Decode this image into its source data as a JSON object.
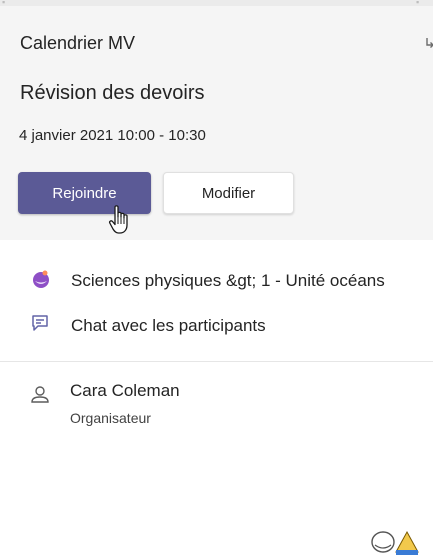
{
  "calendar": {
    "name": "Calendrier MV"
  },
  "meeting": {
    "title": "Révision des devoirs",
    "datetime": "4 janvier 2021 10:00 - 10:30"
  },
  "actions": {
    "join_label": "Rejoindre",
    "edit_label": "Modifier"
  },
  "channel": {
    "label": "Sciences physiques &gt; 1 - Unité océans"
  },
  "chat": {
    "label": "Chat avec les participants"
  },
  "organizer": {
    "name": "Cara Coleman",
    "role": "Organisateur"
  },
  "colors": {
    "primary": "#5b5a96",
    "header_bg": "#f5f5f5",
    "icon": "#6264a7"
  }
}
